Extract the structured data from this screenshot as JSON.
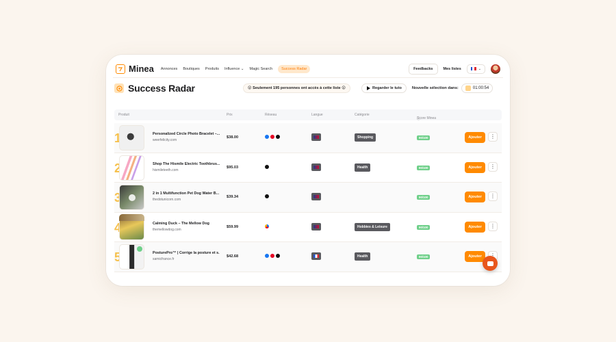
{
  "nav": {
    "brand": "Minea",
    "links": [
      "Annonces",
      "Boutiques",
      "Produits",
      "Influence",
      "Magic Search",
      "Success Radar"
    ],
    "feedbacks": "Feedbacks",
    "lists": "Mes listes"
  },
  "header": {
    "title": "Success Radar",
    "notice": "😲 Seulement 195 personnes ont accès à cette liste 😲",
    "tuto": "Regarder le tuto",
    "next_label": "Nouvelle sélection dans:",
    "timer": "01:00:54"
  },
  "table": {
    "headers": {
      "product": "Produit",
      "price": "Prix",
      "network": "Réseau",
      "language": "Langue",
      "category": "Catégorie",
      "score": "Score Minea"
    },
    "add_label": "Ajouter",
    "rows": [
      {
        "rank": "1",
        "name": "Personalized Circle Photo Bracelet –...",
        "shop": "weerfelicity.com",
        "price": "$38.00",
        "category": "Shopping",
        "score": "90/100"
      },
      {
        "rank": "2",
        "name": "Shop The Hismile Electric Toothbrus...",
        "shop": "hismileteeth.com",
        "price": "$95.03",
        "category": "Health",
        "score": "90/100"
      },
      {
        "rank": "3",
        "name": "2 in 1 Multifunction Pet Dog Water B...",
        "shop": "thedotunicorn.com",
        "price": "$39.34",
        "category": "",
        "score": "90/100"
      },
      {
        "rank": "4",
        "name": "Calming Duck – The Mellow Dog",
        "shop": "themellowdog.com",
        "price": "$59.99",
        "category": "Hobbies & Leisure",
        "score": "90/100"
      },
      {
        "rank": "5",
        "name": "PosturePro™ | Corrige la posture et s...",
        "shop": "samicfrance.fr",
        "price": "$42.68",
        "category": "Health",
        "score": "90/100"
      }
    ]
  },
  "colors": {
    "accent": "#ff8a00",
    "score_green": "#6fd08a",
    "rank_gold": "#f6c14d",
    "chat": "#e8561c"
  }
}
